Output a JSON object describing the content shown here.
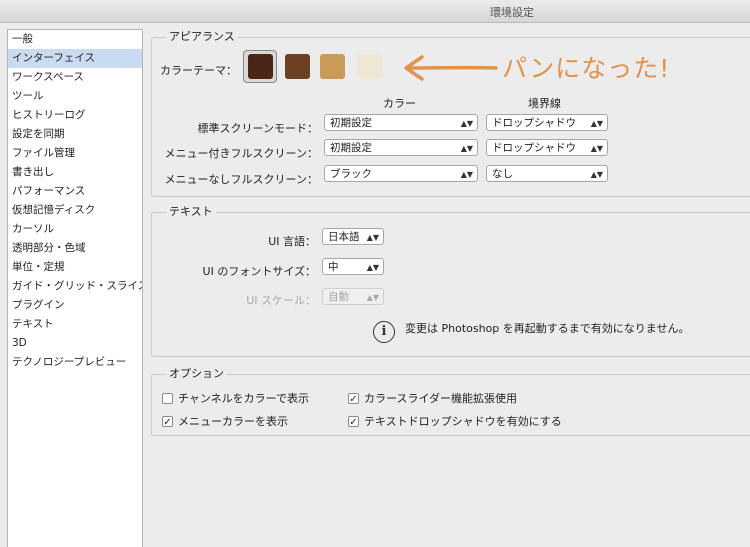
{
  "window": {
    "title": "環境設定"
  },
  "sidebar": {
    "items": [
      {
        "label": "一般",
        "selected": false
      },
      {
        "label": "インターフェイス",
        "selected": true
      },
      {
        "label": "ワークスペース",
        "selected": false
      },
      {
        "label": "ツール",
        "selected": false
      },
      {
        "label": "ヒストリーログ",
        "selected": false
      },
      {
        "label": "設定を同期",
        "selected": false
      },
      {
        "label": "ファイル管理",
        "selected": false
      },
      {
        "label": "書き出し",
        "selected": false
      },
      {
        "label": "パフォーマンス",
        "selected": false
      },
      {
        "label": "仮想記憶ディスク",
        "selected": false
      },
      {
        "label": "カーソル",
        "selected": false
      },
      {
        "label": "透明部分・色域",
        "selected": false
      },
      {
        "label": "単位・定規",
        "selected": false
      },
      {
        "label": "ガイド・グリッド・スライス",
        "selected": false
      },
      {
        "label": "プラグイン",
        "selected": false
      },
      {
        "label": "テキスト",
        "selected": false
      },
      {
        "label": "3D",
        "selected": false
      },
      {
        "label": "テクノロジープレビュー",
        "selected": false
      }
    ]
  },
  "appearance": {
    "title": "アピアランス",
    "color_theme_label": "カラーテーマ：",
    "swatch_colors": [
      "#4a2618",
      "#6d3f23",
      "#c99a5a",
      "#efe7d6"
    ],
    "selected_theme_index": 0,
    "col_color": "カラー",
    "col_border": "境界線",
    "rows": [
      {
        "label": "標準スクリーンモード：",
        "color": "初期設定",
        "border": "ドロップシャドウ"
      },
      {
        "label": "メニュー付きフルスクリーン：",
        "color": "初期設定",
        "border": "ドロップシャドウ"
      },
      {
        "label": "メニューなしフルスクリーン：",
        "color": "ブラック",
        "border": "なし"
      }
    ],
    "annotation": "パンになった!",
    "annotation_color": "#e0934a"
  },
  "text": {
    "title": "テキスト",
    "lang_label": "UI 言語：",
    "lang_value": "日本語",
    "font_size_label": "UI のフォントサイズ：",
    "font_size_value": "中",
    "scale_label": "UI スケール：",
    "scale_value": "自動",
    "info": "変更は Photoshop を再起動するまで有効になりません。"
  },
  "options": {
    "title": "オプション",
    "checkboxes": [
      {
        "label": "チャンネルをカラーで表示",
        "checked": false
      },
      {
        "label": "カラースライダー機能拡張使用",
        "checked": true
      },
      {
        "label": "メニューカラーを表示",
        "checked": true
      },
      {
        "label": "テキストドロップシャドウを有効にする",
        "checked": true
      }
    ]
  }
}
